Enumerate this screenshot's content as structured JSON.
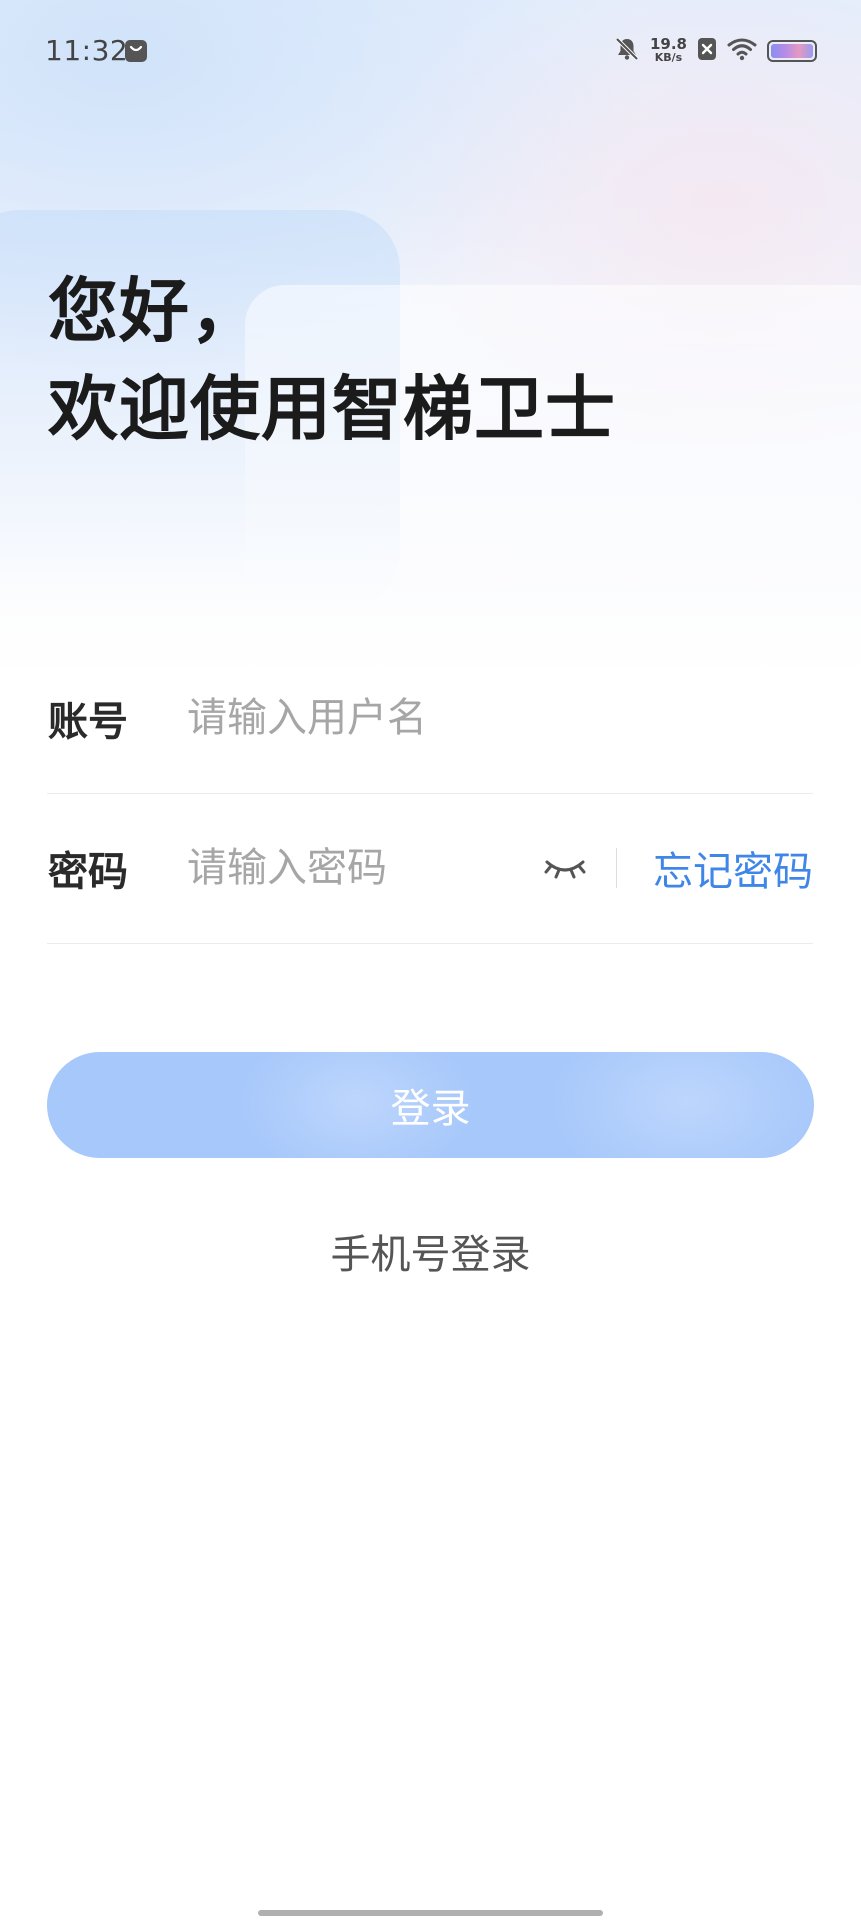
{
  "status_bar": {
    "time": "11:32",
    "net_speed_value": "19.8",
    "net_speed_unit": "KB/s"
  },
  "greeting": {
    "line1": "您好，",
    "line2": "欢迎使用智梯卫士"
  },
  "form": {
    "account_label": "账号",
    "account_placeholder": "请输入用户名",
    "password_label": "密码",
    "password_placeholder": "请输入密码",
    "forgot_password": "忘记密码"
  },
  "actions": {
    "login_label": "登录",
    "phone_login_label": "手机号登录"
  },
  "colors": {
    "accent": "#3f86e8",
    "login_button": "#a7c8fb"
  }
}
